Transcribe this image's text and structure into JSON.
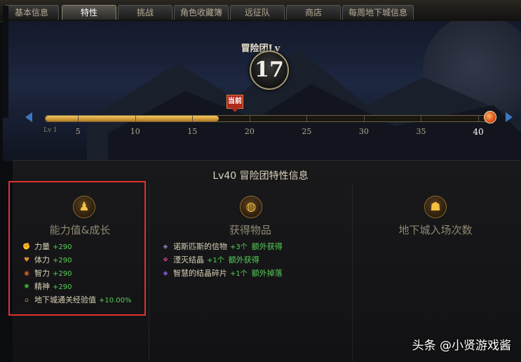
{
  "tabs": [
    {
      "label": "基本信息",
      "active": false
    },
    {
      "label": "特性",
      "active": true
    },
    {
      "label": "挑战",
      "active": false
    },
    {
      "label": "角色收藏簿",
      "active": false
    },
    {
      "label": "远征队",
      "active": false
    },
    {
      "label": "商店",
      "active": false
    },
    {
      "label": "每周地下城信息",
      "active": false
    }
  ],
  "level": {
    "title": "冒险团Lv",
    "value": "17",
    "current_marker": "当前"
  },
  "progress": {
    "min_label": "Lv 1",
    "ticks": [
      "5",
      "10",
      "15",
      "20",
      "25",
      "30",
      "35",
      "40"
    ],
    "current": 17,
    "max": 40
  },
  "info": {
    "title": "Lv40  冒险团特性信息",
    "columns": {
      "ability": "能力值&成长",
      "items": "获得物品",
      "dungeon": "地下城入场次数"
    }
  },
  "stats": [
    {
      "name": "力量",
      "value": "+290",
      "icon": "strength-icon",
      "color": "#e0a040"
    },
    {
      "name": "体力",
      "value": "+290",
      "icon": "vitality-icon",
      "color": "#e09030"
    },
    {
      "name": "智力",
      "value": "+290",
      "icon": "intelligence-icon",
      "color": "#d06020"
    },
    {
      "name": "精神",
      "value": "+290",
      "icon": "spirit-icon",
      "color": "#40b040"
    },
    {
      "name": "地下城通关经验值",
      "value": "+10.00%",
      "icon": "exp-icon",
      "color": "#b08050"
    }
  ],
  "items": [
    {
      "name": "诺斯匹斯的信物",
      "qty": "+3个",
      "note": "额外获得",
      "icon": "token-icon",
      "color": "#8090d0"
    },
    {
      "name": "湮灭结晶",
      "qty": "+1个",
      "note": "额外获得",
      "icon": "crystal-icon",
      "color": "#c04080"
    },
    {
      "name": "智慧的结晶碎片",
      "qty": "+1个",
      "note": "额外掉落",
      "icon": "shard-icon",
      "color": "#7050c0"
    }
  ],
  "watermark": "头条 @小贤游戏酱"
}
